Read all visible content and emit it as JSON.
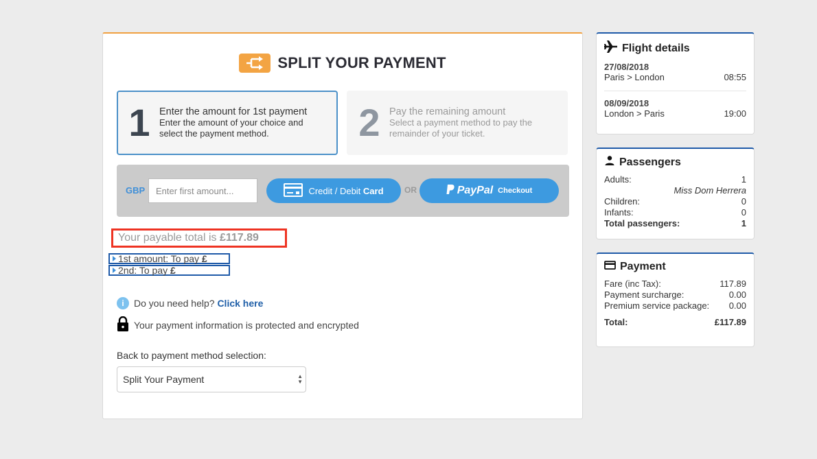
{
  "header": {
    "title": "SPLIT YOUR PAYMENT",
    "icon": "split-arrows-icon",
    "accent_color": "#f3a443"
  },
  "steps": [
    {
      "number": "1",
      "title": "Enter the amount for 1st payment",
      "description": "Enter the amount of your choice and select the payment method.",
      "active": true
    },
    {
      "number": "2",
      "title": "Pay the remaining amount",
      "description": "Select a payment method to pay the remainder of your ticket.",
      "active": false
    }
  ],
  "payment_bar": {
    "currency": "GBP",
    "amount_placeholder": "Enter first amount...",
    "amount_value": "",
    "card_button": {
      "label_light": "Credit / Debit ",
      "label_bold": "Card"
    },
    "or_label": "OR",
    "paypal_button": {
      "label_brand": "PayPal",
      "label_suffix": "Checkout"
    },
    "button_color": "#3d9ae0"
  },
  "total": {
    "prefix": "Your payable total is ",
    "amount": "£117.89"
  },
  "split_lines": [
    {
      "label": "1st amount: To pay ",
      "currency": "£"
    },
    {
      "label": "2nd: To pay ",
      "currency": "£"
    }
  ],
  "help": {
    "text": "Do you need help? ",
    "link": "Click here"
  },
  "secure_text": "Your payment information is protected and encrypted",
  "back_selection": {
    "label": "Back to payment method selection:",
    "selected": "Split Your Payment"
  },
  "sidebar": {
    "flight": {
      "title": "Flight details",
      "legs": [
        {
          "date": "27/08/2018",
          "route": "Paris > London",
          "time": "08:55"
        },
        {
          "date": "08/09/2018",
          "route": "London > Paris",
          "time": "19:00"
        }
      ]
    },
    "passengers": {
      "title": "Passengers",
      "adults_label": "Adults:",
      "adults": "1",
      "passenger_name": "Miss Dom Herrera",
      "children_label": "Children:",
      "children": "0",
      "infants_label": "Infants:",
      "infants": "0",
      "total_label": "Total passengers:",
      "total": "1"
    },
    "payment": {
      "title": "Payment",
      "fare_label": "Fare (inc Tax):",
      "fare": "117.89",
      "surcharge_label": "Payment surcharge:",
      "surcharge": "0.00",
      "premium_label": "Premium service package:",
      "premium": "0.00",
      "total_label": "Total:",
      "total": "£117.89"
    }
  }
}
